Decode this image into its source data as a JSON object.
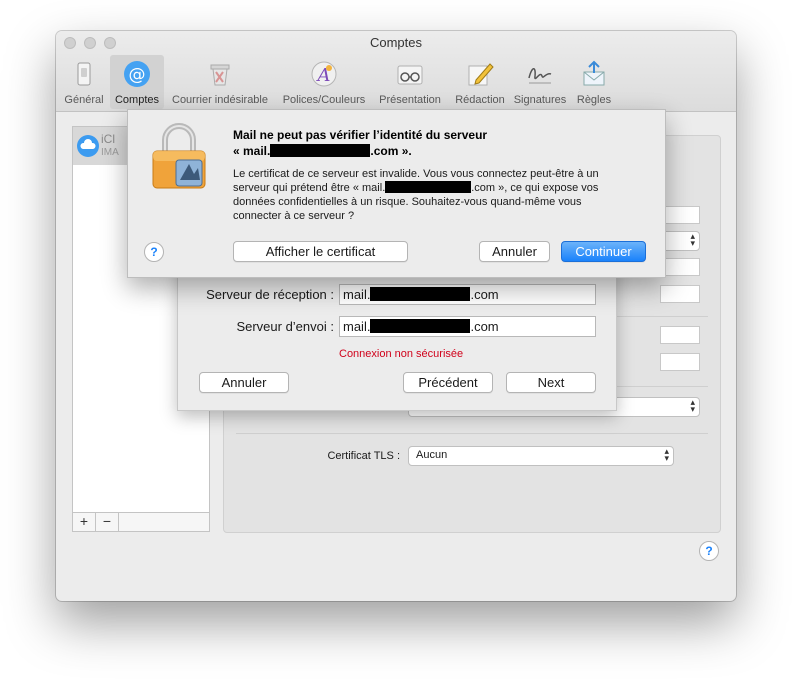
{
  "window": {
    "title": "Comptes"
  },
  "toolbar": {
    "items": [
      {
        "label": "Général",
        "icon": "general-switch-icon"
      },
      {
        "label": "Comptes",
        "icon": "at-sign-icon",
        "selected": true
      },
      {
        "label": "Courrier indésirable",
        "icon": "trash-bin-icon"
      },
      {
        "label": "Polices/Couleurs",
        "icon": "fonts-colors-icon"
      },
      {
        "label": "Présentation",
        "icon": "glasses-icon"
      },
      {
        "label": "Rédaction",
        "icon": "pencil-paper-icon"
      },
      {
        "label": "Signatures",
        "icon": "signature-icon"
      },
      {
        "label": "Règles",
        "icon": "rules-envelope-icon"
      }
    ]
  },
  "accounts": {
    "name": "iCl",
    "type": "IMA",
    "add_label": "+",
    "remove_label": "−"
  },
  "settings": {
    "tls_label": "Certificat TLS :",
    "tls_value": "Aucun"
  },
  "setup_sheet": {
    "incoming_label": "Serveur de réception :",
    "outgoing_label": "Serveur d’envoi :",
    "server_prefix": "mail.",
    "server_suffix": ".com",
    "warning": "Connexion non sécurisée",
    "cancel_label": "Annuler",
    "previous_label": "Précédent",
    "next_label": "Next"
  },
  "alert": {
    "title_line1": "Mail ne peut pas vérifier l’identité du serveur",
    "title_line2_prefix": "« mail.",
    "title_line2_suffix": ".com ».",
    "body_line1": "Le certificat de ce serveur est invalide. Vous vous connectez peut-être à un",
    "body_line2_prefix": "serveur qui prétend être « mail.",
    "body_line2_suffix": ".com », ce qui expose vos",
    "body_line3": "données confidentielles à un risque. Souhaitez-vous quand-même vous",
    "body_line4": "connecter à ce serveur ?",
    "show_cert_label": "Afficher le certificat",
    "cancel_label": "Annuler",
    "continue_label": "Continuer",
    "help_label": "?"
  },
  "help_label": "?",
  "colors": {
    "accent": "#1a82fb",
    "warning": "#d0021b",
    "window_bg": "#ececec"
  }
}
